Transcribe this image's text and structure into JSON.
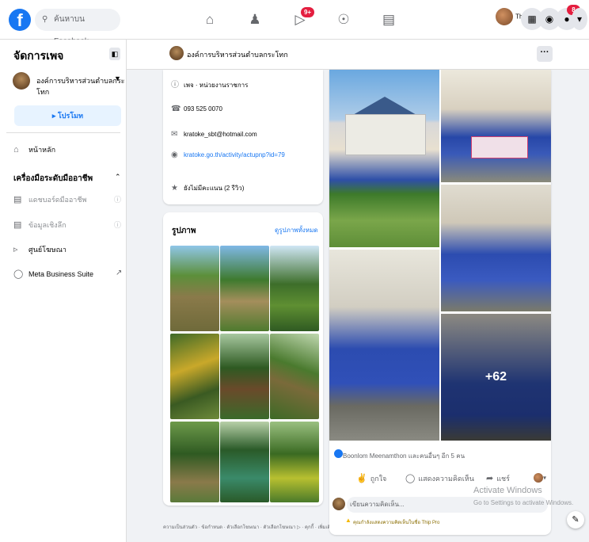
{
  "topbar": {
    "search_placeholder": "ค้นหาบน Facebook",
    "nav_badges": {
      "video": "9+"
    },
    "profile_name": "Thip",
    "notif_badge": "8"
  },
  "sidebar": {
    "title": "จัดการเพจ",
    "page_name": "องค์การบริหารส่วนตำบลกระโทก",
    "promote_label": "โปรโมท",
    "home_label": "หน้าหลัก",
    "section_title": "เครื่องมือระดับมืออาชีพ",
    "tools": [
      {
        "label": "แดชบอร์ดมืออาชีพ"
      },
      {
        "label": "ข้อมูลเชิงลึก"
      }
    ],
    "ad_center_label": "ศูนย์โฆษณา",
    "meta_suite_label": "Meta Business Suite"
  },
  "page_header": {
    "name": "องค์การบริหารส่วนตำบลกระโทก",
    "more": "···"
  },
  "intro": {
    "rows": [
      {
        "icon": "info-icon",
        "text": "เพจ · หน่วยงานราชการ"
      },
      {
        "icon": "phone-icon",
        "text": "093 525 0070"
      },
      {
        "icon": "email-icon",
        "text": "kratoke_sbt@hotmail.com"
      },
      {
        "icon": "globe-icon",
        "text": "kratoke.go.th/activity/actupnp?id=79"
      },
      {
        "icon": "star-icon",
        "text": "ยังไม่มีคะแนน (2 รีวิว)"
      }
    ]
  },
  "photos": {
    "title": "รูปภาพ",
    "see_all": "ดูรูปภาพทั้งหมด"
  },
  "footer": "ความเป็นส่วนตัว · ข้อกำหนด · ตัวเลือกโฆษณา · ตัวเลือกโฆษณา ▷ · คุกกี้ · เพิ่มเติม · Meta © 2022",
  "post": {
    "more_photos": "+62",
    "reactions": "Boonlom Meenamthon และคนอื่นๆ อีก 5 คน",
    "like": "ถูกใจ",
    "comment": "แสดงความคิดเห็น",
    "share": "แชร์",
    "comment_placeholder": "เขียนความคิดเห็น...",
    "warning": "คุณกำลังแสดงความคิดเห็นในชื่อ Thip Pro"
  },
  "watermark": {
    "line1": "Activate Windows",
    "line2": "Go to Settings to activate Windows."
  },
  "colors": {
    "brand": "#1877f2",
    "badge": "#e41e3f"
  }
}
